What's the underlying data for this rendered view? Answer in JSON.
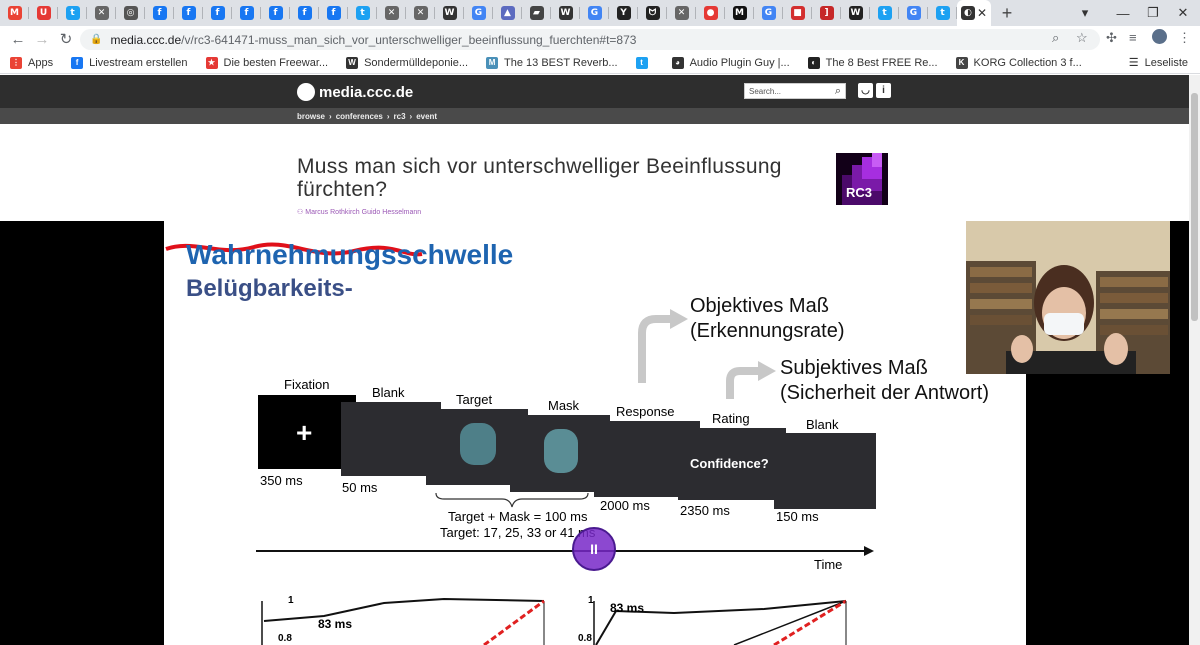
{
  "browser": {
    "tabs": [
      {
        "icon": "gmail-icon",
        "glyph": "M",
        "color": "#ea4335"
      },
      {
        "icon": "shield-icon",
        "glyph": "U",
        "color": "#e53935"
      },
      {
        "icon": "twitter-icon",
        "glyph": "t",
        "color": "#1da1f2"
      },
      {
        "icon": "cross-icon",
        "glyph": "✕",
        "color": "#666666"
      },
      {
        "icon": "globe-icon",
        "glyph": "◎",
        "color": "#555555"
      },
      {
        "icon": "facebook-icon",
        "glyph": "f",
        "color": "#1877f2"
      },
      {
        "icon": "facebook-icon",
        "glyph": "f",
        "color": "#1877f2"
      },
      {
        "icon": "facebook-icon",
        "glyph": "f",
        "color": "#1877f2"
      },
      {
        "icon": "facebook-icon",
        "glyph": "f",
        "color": "#1877f2"
      },
      {
        "icon": "facebook-icon",
        "glyph": "f",
        "color": "#1877f2"
      },
      {
        "icon": "facebook-icon",
        "glyph": "f",
        "color": "#1877f2"
      },
      {
        "icon": "facebook-icon",
        "glyph": "f",
        "color": "#1877f2"
      },
      {
        "icon": "twitter-icon",
        "glyph": "t",
        "color": "#1da1f2"
      },
      {
        "icon": "cross-icon",
        "glyph": "✕",
        "color": "#666666"
      },
      {
        "icon": "cross-icon",
        "glyph": "✕",
        "color": "#666666"
      },
      {
        "icon": "wiki-icon",
        "glyph": "W",
        "color": "#333333"
      },
      {
        "icon": "google-icon",
        "glyph": "G",
        "color": "#4285f4"
      },
      {
        "icon": "people-icon",
        "glyph": "▲",
        "color": "#5c6bc0"
      },
      {
        "icon": "logo-icon",
        "glyph": "▰",
        "color": "#444444"
      },
      {
        "icon": "wiki-icon",
        "glyph": "W",
        "color": "#333333"
      },
      {
        "icon": "google-icon",
        "glyph": "G",
        "color": "#4285f4"
      },
      {
        "icon": "y-icon",
        "glyph": "Y",
        "color": "#222222"
      },
      {
        "icon": "cat-icon",
        "glyph": "ᗢ",
        "color": "#222222"
      },
      {
        "icon": "cross-icon",
        "glyph": "✕",
        "color": "#666666"
      },
      {
        "icon": "record-icon",
        "glyph": "●",
        "color": "#e53935"
      },
      {
        "icon": "m-icon",
        "glyph": "M",
        "color": "#111111"
      },
      {
        "icon": "google-icon",
        "glyph": "G",
        "color": "#4285f4"
      },
      {
        "icon": "red-square-icon",
        "glyph": "■",
        "color": "#d32f2f"
      },
      {
        "icon": "bracket-icon",
        "glyph": "]",
        "color": "#c62828"
      },
      {
        "icon": "wikipedia-icon",
        "glyph": "W",
        "color": "#222222"
      },
      {
        "icon": "twitter-icon",
        "glyph": "t",
        "color": "#1da1f2"
      },
      {
        "icon": "google-icon",
        "glyph": "G",
        "color": "#4285f4"
      },
      {
        "icon": "twitter-icon",
        "glyph": "t",
        "color": "#1da1f2"
      }
    ],
    "active_tab": {
      "icon": "ccc-icon",
      "glyph": "◐",
      "close": "✕"
    },
    "new_tab": "+",
    "url_host": "media.ccc.de",
    "url_path": "/v/rc3-641471-muss_man_sich_vor_unterschwelliger_beeinflussung_fuerchten#t=873",
    "bookmarks": [
      {
        "icon": "apps-icon",
        "label": "Apps",
        "color": "#ea4335",
        "glyph": "⋮"
      },
      {
        "icon": "facebook-icon",
        "label": "Livestream erstellen",
        "color": "#1877f2",
        "glyph": "f"
      },
      {
        "icon": "star-icon",
        "label": "Die besten Freewar...",
        "color": "#e53935",
        "glyph": "★"
      },
      {
        "icon": "w-icon",
        "label": "Sondermülldeponie...",
        "color": "#333333",
        "glyph": "W"
      },
      {
        "icon": "m-icon",
        "label": "The 13 BEST Reverb...",
        "color": "#4a90b8",
        "glyph": "M"
      },
      {
        "icon": "twitter-icon",
        "label": "",
        "color": "#1da1f2",
        "glyph": "t"
      },
      {
        "icon": "plugin-icon",
        "label": "Audio Plugin Guy |...",
        "color": "#333333",
        "glyph": "◕"
      },
      {
        "icon": "moon-icon",
        "label": "The 8 Best FREE Re...",
        "color": "#222222",
        "glyph": "◐"
      },
      {
        "icon": "korg-icon",
        "label": "KORG Collection 3 f...",
        "color": "#444444",
        "glyph": "K"
      }
    ],
    "reading_list": "Leseliste"
  },
  "site": {
    "logo": "media.ccc.de",
    "search_placeholder": "Search...",
    "breadcrumbs": [
      "browse",
      "›",
      "conferences",
      "›",
      "rc3",
      "›",
      "event"
    ],
    "title": "Muss man sich vor unterschwelliger Beeinflussung fürchten?",
    "persons": "Marcus Rothkirch Guido Hesselmann",
    "conference_logo": "RC3"
  },
  "slide": {
    "heading_crossed": "Wahrnehmungsschwelle",
    "heading_replacement": "Belügbarkeits-",
    "objective_line1": "Objektives Maß",
    "objective_line2": "(Erkennungsrate)",
    "subjective_line1": "Subjektives Maß",
    "subjective_line2": "(Sicherheit der Antwort)",
    "steps": [
      {
        "label": "Fixation",
        "duration": "350 ms"
      },
      {
        "label": "Blank",
        "duration": "50 ms"
      },
      {
        "label": "Target",
        "duration": ""
      },
      {
        "label": "Mask",
        "duration": ""
      },
      {
        "label": "Response",
        "duration": "2000 ms"
      },
      {
        "label": "Rating",
        "duration": "2350 ms"
      },
      {
        "label": "Blank",
        "duration": "150 ms"
      }
    ],
    "confidence_text": "Confidence?",
    "target_mask_line1": "Target + Mask = 100 ms",
    "target_mask_line2": "Target: 17, 25, 33 or 41 ms",
    "time_label": "Time",
    "graph_left_label": "83 ms",
    "graph_right_label": "83 ms",
    "axis_top": "1",
    "axis_mid": "0.8"
  }
}
